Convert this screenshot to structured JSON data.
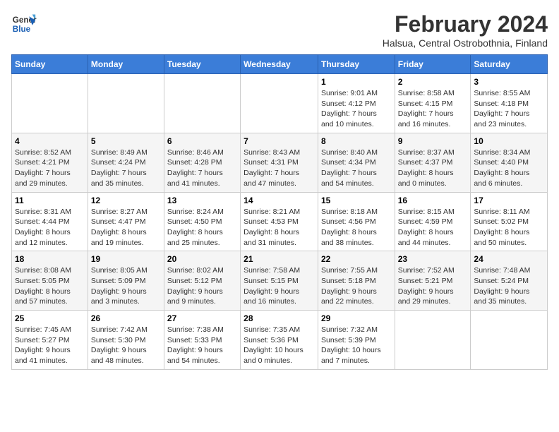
{
  "header": {
    "logo_text_general": "General",
    "logo_text_blue": "Blue",
    "title": "February 2024",
    "subtitle": "Halsua, Central Ostrobothnia, Finland"
  },
  "days_of_week": [
    "Sunday",
    "Monday",
    "Tuesday",
    "Wednesday",
    "Thursday",
    "Friday",
    "Saturday"
  ],
  "weeks": [
    [
      {
        "day": "",
        "info": ""
      },
      {
        "day": "",
        "info": ""
      },
      {
        "day": "",
        "info": ""
      },
      {
        "day": "",
        "info": ""
      },
      {
        "day": "1",
        "info": "Sunrise: 9:01 AM\nSunset: 4:12 PM\nDaylight: 7 hours\nand 10 minutes."
      },
      {
        "day": "2",
        "info": "Sunrise: 8:58 AM\nSunset: 4:15 PM\nDaylight: 7 hours\nand 16 minutes."
      },
      {
        "day": "3",
        "info": "Sunrise: 8:55 AM\nSunset: 4:18 PM\nDaylight: 7 hours\nand 23 minutes."
      }
    ],
    [
      {
        "day": "4",
        "info": "Sunrise: 8:52 AM\nSunset: 4:21 PM\nDaylight: 7 hours\nand 29 minutes."
      },
      {
        "day": "5",
        "info": "Sunrise: 8:49 AM\nSunset: 4:24 PM\nDaylight: 7 hours\nand 35 minutes."
      },
      {
        "day": "6",
        "info": "Sunrise: 8:46 AM\nSunset: 4:28 PM\nDaylight: 7 hours\nand 41 minutes."
      },
      {
        "day": "7",
        "info": "Sunrise: 8:43 AM\nSunset: 4:31 PM\nDaylight: 7 hours\nand 47 minutes."
      },
      {
        "day": "8",
        "info": "Sunrise: 8:40 AM\nSunset: 4:34 PM\nDaylight: 7 hours\nand 54 minutes."
      },
      {
        "day": "9",
        "info": "Sunrise: 8:37 AM\nSunset: 4:37 PM\nDaylight: 8 hours\nand 0 minutes."
      },
      {
        "day": "10",
        "info": "Sunrise: 8:34 AM\nSunset: 4:40 PM\nDaylight: 8 hours\nand 6 minutes."
      }
    ],
    [
      {
        "day": "11",
        "info": "Sunrise: 8:31 AM\nSunset: 4:44 PM\nDaylight: 8 hours\nand 12 minutes."
      },
      {
        "day": "12",
        "info": "Sunrise: 8:27 AM\nSunset: 4:47 PM\nDaylight: 8 hours\nand 19 minutes."
      },
      {
        "day": "13",
        "info": "Sunrise: 8:24 AM\nSunset: 4:50 PM\nDaylight: 8 hours\nand 25 minutes."
      },
      {
        "day": "14",
        "info": "Sunrise: 8:21 AM\nSunset: 4:53 PM\nDaylight: 8 hours\nand 31 minutes."
      },
      {
        "day": "15",
        "info": "Sunrise: 8:18 AM\nSunset: 4:56 PM\nDaylight: 8 hours\nand 38 minutes."
      },
      {
        "day": "16",
        "info": "Sunrise: 8:15 AM\nSunset: 4:59 PM\nDaylight: 8 hours\nand 44 minutes."
      },
      {
        "day": "17",
        "info": "Sunrise: 8:11 AM\nSunset: 5:02 PM\nDaylight: 8 hours\nand 50 minutes."
      }
    ],
    [
      {
        "day": "18",
        "info": "Sunrise: 8:08 AM\nSunset: 5:05 PM\nDaylight: 8 hours\nand 57 minutes."
      },
      {
        "day": "19",
        "info": "Sunrise: 8:05 AM\nSunset: 5:09 PM\nDaylight: 9 hours\nand 3 minutes."
      },
      {
        "day": "20",
        "info": "Sunrise: 8:02 AM\nSunset: 5:12 PM\nDaylight: 9 hours\nand 9 minutes."
      },
      {
        "day": "21",
        "info": "Sunrise: 7:58 AM\nSunset: 5:15 PM\nDaylight: 9 hours\nand 16 minutes."
      },
      {
        "day": "22",
        "info": "Sunrise: 7:55 AM\nSunset: 5:18 PM\nDaylight: 9 hours\nand 22 minutes."
      },
      {
        "day": "23",
        "info": "Sunrise: 7:52 AM\nSunset: 5:21 PM\nDaylight: 9 hours\nand 29 minutes."
      },
      {
        "day": "24",
        "info": "Sunrise: 7:48 AM\nSunset: 5:24 PM\nDaylight: 9 hours\nand 35 minutes."
      }
    ],
    [
      {
        "day": "25",
        "info": "Sunrise: 7:45 AM\nSunset: 5:27 PM\nDaylight: 9 hours\nand 41 minutes."
      },
      {
        "day": "26",
        "info": "Sunrise: 7:42 AM\nSunset: 5:30 PM\nDaylight: 9 hours\nand 48 minutes."
      },
      {
        "day": "27",
        "info": "Sunrise: 7:38 AM\nSunset: 5:33 PM\nDaylight: 9 hours\nand 54 minutes."
      },
      {
        "day": "28",
        "info": "Sunrise: 7:35 AM\nSunset: 5:36 PM\nDaylight: 10 hours\nand 0 minutes."
      },
      {
        "day": "29",
        "info": "Sunrise: 7:32 AM\nSunset: 5:39 PM\nDaylight: 10 hours\nand 7 minutes."
      },
      {
        "day": "",
        "info": ""
      },
      {
        "day": "",
        "info": ""
      }
    ]
  ]
}
